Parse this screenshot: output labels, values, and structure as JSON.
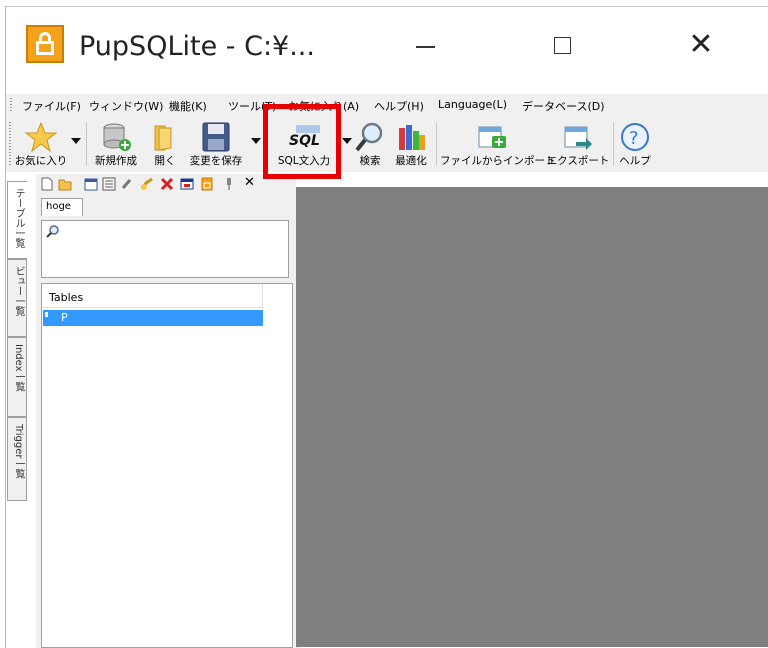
{
  "window": {
    "title": "PupSQLite - C:¥...",
    "minimize_glyph": "",
    "close_glyph": "✕"
  },
  "menu": [
    {
      "label": "ファイル(F)"
    },
    {
      "label": "ウィンドウ(W)"
    },
    {
      "label": "機能(K)"
    },
    {
      "label": "ツール(T)"
    },
    {
      "label": "お気に入り(A)"
    },
    {
      "label": "ヘルプ(H)"
    },
    {
      "label": "Language(L)"
    },
    {
      "label": "データベース(D)"
    }
  ],
  "toolbar": {
    "favorites": "お気に入り",
    "new": "新規作成",
    "open": "開く",
    "save_changes": "変更を保存",
    "sql_input": "SQL文入力",
    "sql_icon_text": "SQL",
    "search": "検索",
    "optimize": "最適化",
    "import_file": "ファイルからインポート",
    "export": "エクスポート",
    "help": "ヘルプ",
    "help_glyph": "?"
  },
  "subtoolbar": {
    "close_glyph": "✕"
  },
  "side_tabs": [
    {
      "label": "テーブル一覧"
    },
    {
      "label": "ビュー一覧"
    },
    {
      "label": "Index一覧"
    },
    {
      "label": "Trigger一覧"
    }
  ],
  "panel": {
    "db_tab": "hoge",
    "tree_header": "Tables",
    "tree_items": [
      {
        "name": "P"
      }
    ]
  },
  "colors": {
    "highlight": "#e60000",
    "selection": "#3399ff",
    "content_background": "#7f7f7f",
    "app_icon": "#f3a21a"
  }
}
